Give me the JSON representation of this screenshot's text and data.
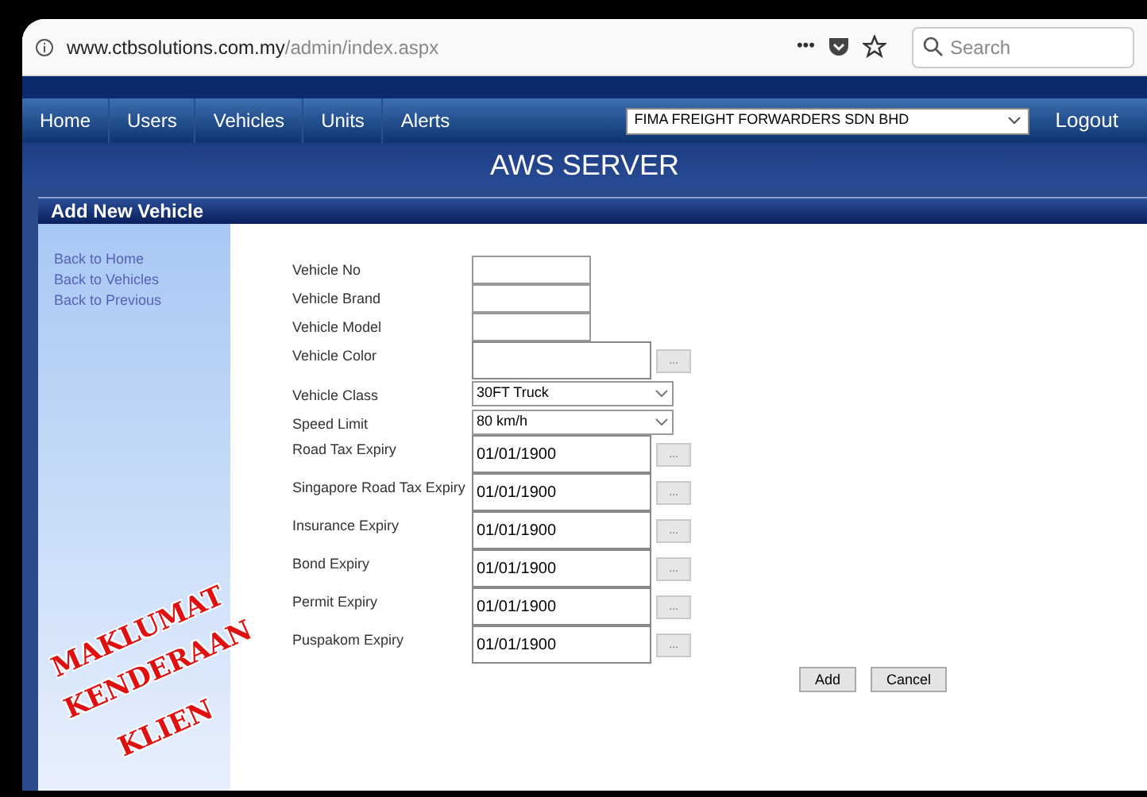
{
  "browser": {
    "url_host": "www.ctbsolutions.com.my",
    "url_path": "/admin/index.aspx",
    "more": "•••",
    "search_placeholder": "Search"
  },
  "nav": {
    "items": [
      {
        "label": "Home"
      },
      {
        "label": "Users"
      },
      {
        "label": "Vehicles"
      },
      {
        "label": "Units"
      },
      {
        "label": "Alerts"
      }
    ],
    "company": "FIMA FREIGHT FORWARDERS SDN BHD",
    "logout": "Logout"
  },
  "banner": "AWS SERVER",
  "panel_title": "Add New Vehicle",
  "sidebar": {
    "links": [
      {
        "label": "Back to Home"
      },
      {
        "label": "Back to Vehicles"
      },
      {
        "label": "Back to Previous"
      }
    ]
  },
  "form": {
    "fields": [
      {
        "kind": "text",
        "label": "Vehicle No"
      },
      {
        "kind": "text",
        "label": "Vehicle Brand"
      },
      {
        "kind": "text",
        "label": "Vehicle Model"
      },
      {
        "kind": "picker",
        "label": "Vehicle Color",
        "button": "..."
      },
      {
        "kind": "select",
        "label": "Vehicle Class",
        "value": "30FT Truck"
      },
      {
        "kind": "select",
        "label": "Speed Limit",
        "value": "80 km/h"
      },
      {
        "kind": "picker",
        "label": "Road Tax Expiry",
        "value": "01/01/1900",
        "button": "..."
      },
      {
        "kind": "picker",
        "label": "Singapore Road Tax Expiry",
        "value": "01/01/1900",
        "button": "..."
      },
      {
        "kind": "picker",
        "label": "Insurance Expiry",
        "value": "01/01/1900",
        "button": "..."
      },
      {
        "kind": "picker",
        "label": "Bond Expiry",
        "value": "01/01/1900",
        "button": "..."
      },
      {
        "kind": "picker",
        "label": "Permit Expiry",
        "value": "01/01/1900",
        "button": "..."
      },
      {
        "kind": "picker",
        "label": "Puspakom Expiry",
        "value": "01/01/1900",
        "button": "..."
      }
    ],
    "buttons": [
      "Add",
      "Cancel"
    ]
  },
  "annotation": [
    "MAKLUMAT",
    "KENDERAAN",
    "KLIEN"
  ]
}
